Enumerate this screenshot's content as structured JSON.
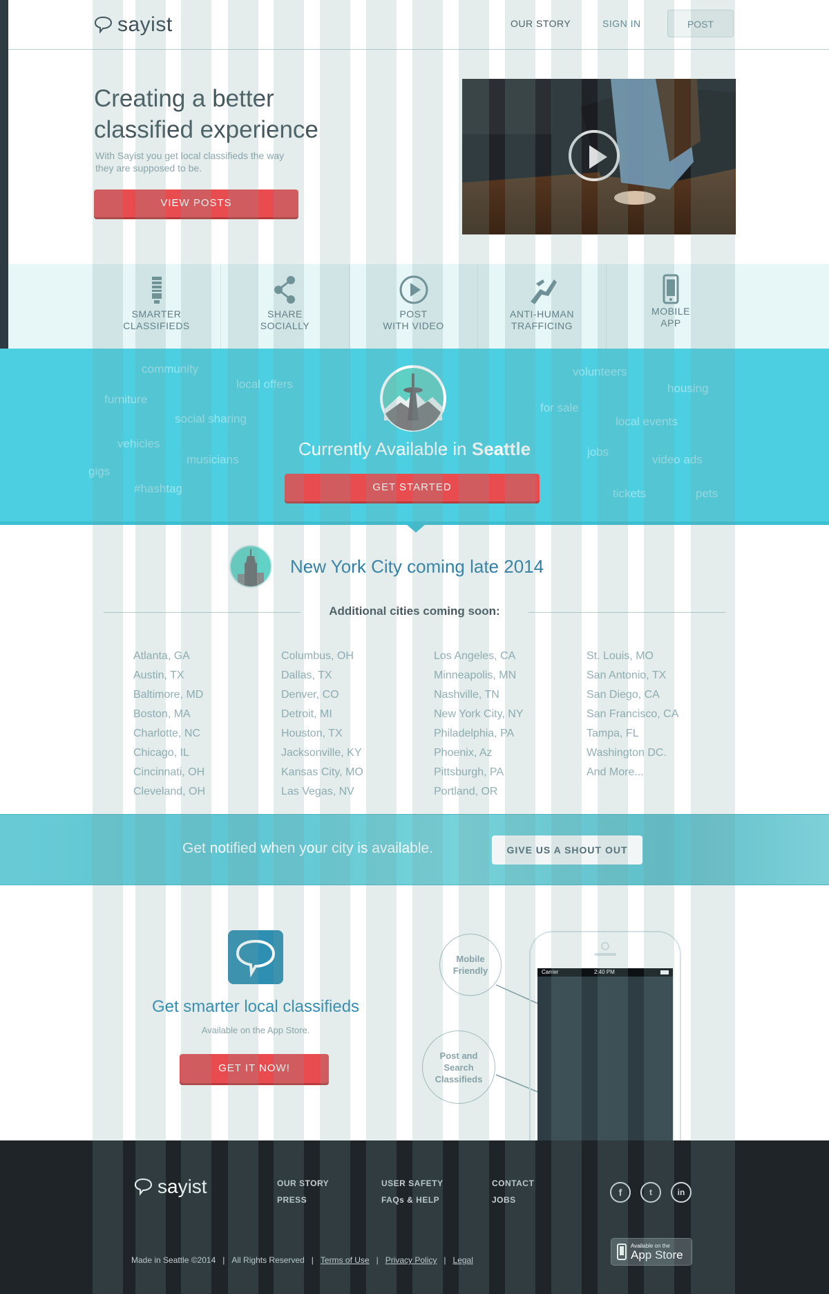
{
  "brand": {
    "name": "sayist"
  },
  "nav": {
    "our_story": "OUR STORY",
    "sign_in": "SIGN IN",
    "post": "POST"
  },
  "hero": {
    "title_line1": "Creating a better",
    "title_line2": "classified experience",
    "subtitle_line1": "With Sayist you get local classifieds the way",
    "subtitle_line2": "they are supposed to be.",
    "cta": "VIEW POSTS"
  },
  "features": [
    {
      "icon": "lightbulb-icon",
      "line1": "SMARTER",
      "line2": "CLASSIFIEDS"
    },
    {
      "icon": "share-icon",
      "line1": "SHARE",
      "line2": "SOCIALLY"
    },
    {
      "icon": "play-icon",
      "line1": "POST",
      "line2": "WITH VIDEO"
    },
    {
      "icon": "hands-icon",
      "line1": "ANTI-HUMAN",
      "line2": "TRAFFICING"
    },
    {
      "icon": "mobile-phone-icon",
      "line1": "MOBILE",
      "line2": "APP"
    }
  ],
  "tags": [
    "community",
    "local offers",
    "furniture",
    "social sharing",
    "vehicles",
    "musicians",
    "gigs",
    "#hashtag",
    "volunteers",
    "housing",
    "for sale",
    "local events",
    "jobs",
    "video ads",
    "tickets",
    "pets"
  ],
  "seattle": {
    "available_prefix": "Currently Available in",
    "city": "Seattle",
    "cta": "GET STARTED"
  },
  "nyc": {
    "text": "New York City coming late 2014"
  },
  "cities": {
    "title": "Additional cities coming soon:",
    "columns": [
      [
        "Atlanta, GA",
        "Austin, TX",
        "Baltimore, MD",
        "Boston, MA",
        "Charlotte, NC",
        "Chicago, IL",
        "Cincinnati, OH",
        "Cleveland, OH"
      ],
      [
        "Columbus, OH",
        "Dallas, TX",
        "Denver, CO",
        "Detroit, MI",
        "Houston, TX",
        "Jacksonville, KY",
        "Kansas City, MO",
        "Las Vegas, NV"
      ],
      [
        "Los Angeles, CA",
        "Minneapolis, MN",
        "Nashville, TN",
        "New York City, NY",
        "Philadelphia, PA",
        "Phoenix, Az",
        "Pittsburgh, PA",
        "Portland, OR"
      ],
      [
        "St. Louis, MO",
        "San Antonio, TX",
        "San Diego, CA",
        "San Francisco, CA",
        "Tampa, FL",
        "Washington DC.",
        "And More..."
      ]
    ]
  },
  "notify": {
    "text": "Get notified when your city is available.",
    "cta": "GIVE US A SHOUT OUT"
  },
  "app": {
    "title": "Get smarter local classifieds",
    "subtitle": "Available on the App Store.",
    "cta": "GET IT NOW!",
    "callout_1_line1": "Mobile",
    "callout_1_line2": "Friendly",
    "callout_2_line1": "Post and",
    "callout_2_line2": "Search",
    "callout_2_line3": "Classifieds",
    "status_carrier": "Carrier",
    "status_time": "2:40 PM"
  },
  "footer": {
    "links": {
      "our_story": "OUR STORY",
      "press": "PRESS",
      "user_safety": "USER SAFETY",
      "faqs": "FAQs & HELP",
      "contact": "CONTACT",
      "jobs": "JOBS"
    },
    "made_in": "Made in Seattle ©2014",
    "rights": "All Rights Reserved",
    "terms": "Terms of Use",
    "privacy": "Privacy Policy",
    "legal": "Legal",
    "appstore_small": "Available on the",
    "appstore_big": "App Store",
    "social": [
      "facebook-icon",
      "twitter-icon",
      "linkedin-icon"
    ]
  },
  "colors": {
    "accent_red": "#e84c4f",
    "teal": "#4ccfe0",
    "footer_bg": "#1e2427",
    "link_blue": "#2d7fa5"
  }
}
